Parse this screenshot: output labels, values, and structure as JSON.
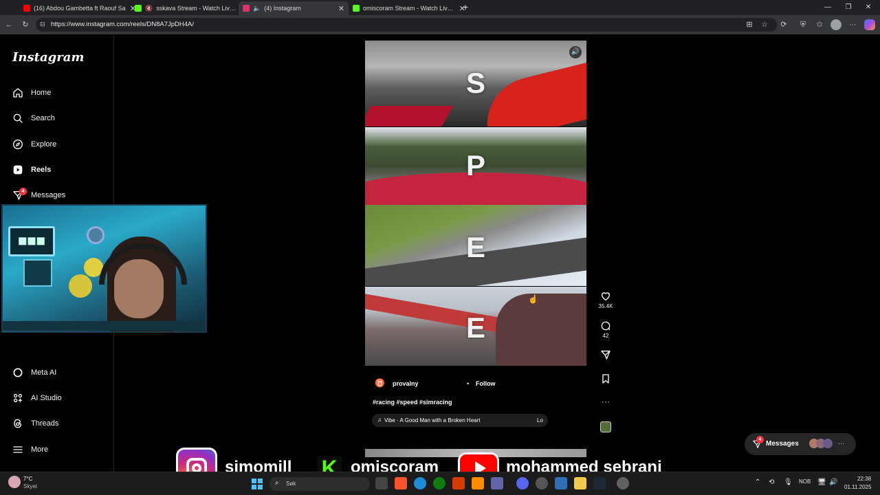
{
  "browser": {
    "tabs": [
      {
        "title": "(16) Abdou Gambetta ft Raouf Sa",
        "color": "#ff0000",
        "active": false
      },
      {
        "title": "sskava Stream - Watch Live o",
        "color": "#53fc18",
        "active": false
      },
      {
        "title": "(4) Instagram",
        "color": "#e1306c",
        "active": true
      },
      {
        "title": "omiscoram Stream - Watch Live o",
        "color": "#53fc18",
        "active": false
      }
    ],
    "new_tab": "+",
    "url": "https://www.instagram.com/reels/DN8A7JpDH4A/"
  },
  "sidebar": {
    "logo": "Instagram",
    "items": [
      {
        "label": "Home",
        "icon": "home-icon"
      },
      {
        "label": "Search",
        "icon": "search-icon"
      },
      {
        "label": "Explore",
        "icon": "compass-icon"
      },
      {
        "label": "Reels",
        "icon": "reels-icon"
      },
      {
        "label": "Messages",
        "icon": "messenger-icon",
        "badge": "4"
      },
      {
        "label": "Meta AI",
        "icon": "meta-ai-icon"
      },
      {
        "label": "AI Studio",
        "icon": "ai-studio-icon"
      },
      {
        "label": "Threads",
        "icon": "threads-icon"
      },
      {
        "label": "More",
        "icon": "menu-icon"
      }
    ]
  },
  "reel": {
    "letters": [
      "S",
      "P",
      "E",
      "E"
    ],
    "username": "provalny",
    "follow": "Follow",
    "separator": "•",
    "caption": "#racing #speed #simracing",
    "audio": "Vibe · A Good Man with a Broken Heart",
    "audio_tail": "Lo"
  },
  "actions": {
    "likes": "35.4K",
    "comments": "42"
  },
  "messages_pill": {
    "label": "Messages",
    "badge": "4",
    "more": "···"
  },
  "overlay": {
    "names": [
      "simomill",
      "omiscoram",
      "mohammed sebrani"
    ]
  },
  "taskbar": {
    "weather_temp": "7°C",
    "weather_desc": "Skyet",
    "search_placeholder": "Søk",
    "language": "NOB",
    "time": "22:38",
    "date": "01.11.2025"
  },
  "colors": {
    "accent_red": "#ff3040",
    "kick_green": "#53fc18"
  }
}
